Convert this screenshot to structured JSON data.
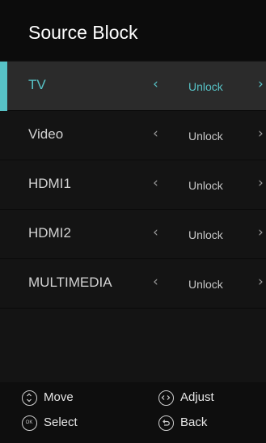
{
  "title": "Source Block",
  "rows": [
    {
      "label": "TV",
      "value": "Unlock",
      "selected": true
    },
    {
      "label": "Video",
      "value": "Unlock",
      "selected": false
    },
    {
      "label": "HDMI1",
      "value": "Unlock",
      "selected": false
    },
    {
      "label": "HDMI2",
      "value": "Unlock",
      "selected": false
    },
    {
      "label": "MULTIMEDIA",
      "value": "Unlock",
      "selected": false
    }
  ],
  "arrows": {
    "left": "‹",
    "right": "›"
  },
  "footer": {
    "move": {
      "label": "Move",
      "icon": "up-down-icon"
    },
    "adjust": {
      "label": "Adjust",
      "icon": "left-right-icon"
    },
    "select": {
      "label": "Select",
      "icon": "ok-icon",
      "icon_text": "OK"
    },
    "back": {
      "label": "Back",
      "icon": "back-icon"
    }
  },
  "colors": {
    "accent": "#57c2c6",
    "background": "#141414",
    "selected_row": "#2b2b2b"
  }
}
